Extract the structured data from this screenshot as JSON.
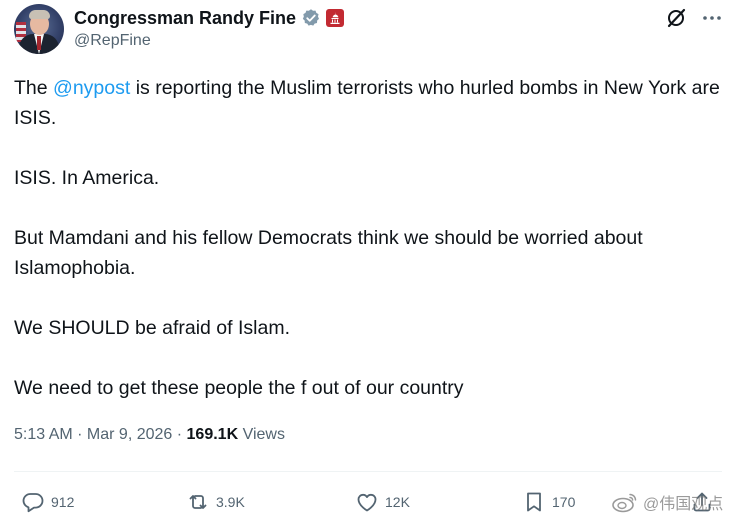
{
  "author": {
    "display_name": "Congressman Randy Fine",
    "handle": "@RepFine",
    "verified_icon": "verified-badge-icon",
    "affiliation_icon": "capitol-building-icon"
  },
  "tweet": {
    "line1_prefix": "The ",
    "mention": "@nypost",
    "line1_suffix": " is reporting the Muslim terrorists who hurled bombs in New York are ISIS.",
    "para2": "ISIS.  In America.",
    "para3": "But Mamdani and his fellow Democrats think we should be worried about Islamophobia.",
    "para4": "We SHOULD be afraid of Islam.",
    "para5": "We need to get these people the f out of our country"
  },
  "meta": {
    "time": "5:13 AM",
    "separator": " · ",
    "date": "Mar 9, 2026",
    "views_count": "169.1K",
    "views_label": " Views"
  },
  "actions": {
    "replies": "912",
    "reposts": "3.9K",
    "likes": "12K",
    "bookmarks": "170"
  },
  "watermark": {
    "text": "@伟国观点"
  },
  "colors": {
    "text": "#0f1419",
    "secondary": "#536471",
    "link": "#1d9bf0",
    "verified": "#829aab",
    "gov_badge": "#c22a32"
  }
}
